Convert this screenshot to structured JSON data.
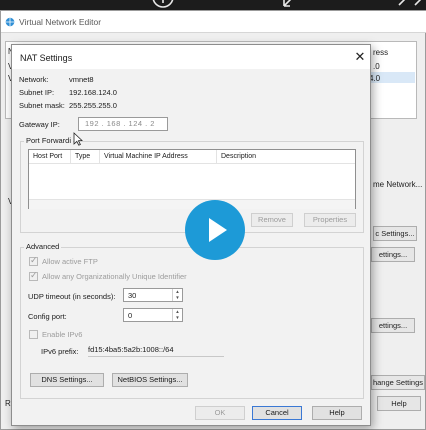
{
  "background_window": {
    "title": "Virtual Network Editor",
    "list_fragments_left": [
      "N",
      "V",
      "V"
    ],
    "list_header_right": "ress",
    "list_values_right": [
      ".0",
      "4.0"
    ],
    "side_fragments": {
      "v_left": "V",
      "r_left": "R",
      "name_network": "me Network..."
    },
    "buttons": {
      "settings_1": "c Settings...",
      "settings_2": "ettings...",
      "settings_3": "ettings...",
      "change_settings": "hange Settings",
      "help": "Help"
    }
  },
  "nat_dialog": {
    "title": "NAT Settings",
    "network_label": "Network:",
    "network_value": "vmnet8",
    "subnet_ip_label": "Subnet IP:",
    "subnet_ip_value": "192.168.124.0",
    "subnet_mask_label": "Subnet mask:",
    "subnet_mask_value": "255.255.255.0",
    "gateway_ip_label": "Gateway IP:",
    "gateway_ip_value": "192 . 168 . 124 . 2",
    "port_forwarding": {
      "title": "Port Forwardi",
      "columns": [
        "Host Port",
        "Type",
        "Virtual Machine IP Address",
        "Description"
      ],
      "remove_label": "Remove",
      "properties_label": "Properties"
    },
    "advanced": {
      "title": "Advanced",
      "allow_ftp_label": "Allow active FTP",
      "allow_oui_label": "Allow any Organizationally Unique Identifier",
      "udp_timeout_label": "UDP timeout (in seconds):",
      "udp_timeout_value": "30",
      "config_port_label": "Config port:",
      "config_port_value": "0",
      "enable_ipv6_label": "Enable IPv6",
      "ipv6_prefix_label": "IPv6 prefix:",
      "ipv6_prefix_value": "fd15:4ba5:5a2b:1008::/64",
      "dns_settings_label": "DNS Settings...",
      "netbios_settings_label": "NetBIOS Settings..."
    },
    "footer": {
      "ok_label": "OK",
      "cancel_label": "Cancel",
      "help_label": "Help"
    }
  },
  "colors": {
    "play_button": "#1d9ad7",
    "dialog_bg": "#f2f2f2",
    "selection": "#d9e8f7"
  },
  "icons": [
    "plus-icon",
    "expand-icon",
    "network-globe-icon",
    "close-icon",
    "play-icon",
    "mouse-cursor-icon"
  ]
}
